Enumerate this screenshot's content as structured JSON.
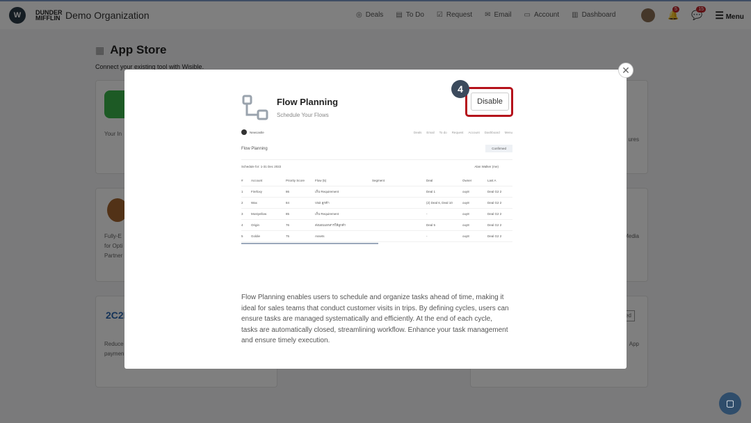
{
  "header": {
    "org_name": "Demo Organization",
    "brand": "DUNDER MIFFLIN",
    "nav": [
      {
        "label": "Deals",
        "icon": "deals-icon"
      },
      {
        "label": "To Do",
        "icon": "todo-icon"
      },
      {
        "label": "Request",
        "icon": "request-icon"
      },
      {
        "label": "Email",
        "icon": "email-icon"
      },
      {
        "label": "Account",
        "icon": "account-icon"
      },
      {
        "label": "Dashboard",
        "icon": "dashboard-icon"
      }
    ],
    "notifications": "5",
    "messages": "15",
    "menu": "Menu"
  },
  "page": {
    "title": "App Store",
    "subtitle": "Connect your existing tool with Wisible."
  },
  "cards": [
    "Your In",
    "ures",
    "Fully-E\nfor Opti\nPartner",
    "Media",
    "Reduce\npaymen",
    "ed",
    "App"
  ],
  "modal": {
    "step": "4",
    "title": "Flow Planning",
    "subtitle": "Schedule Your Flows",
    "disable_label": "Disable",
    "preview": {
      "org": "Newcastle",
      "nav": [
        "Deals",
        "Email",
        "To do",
        "Request",
        "Account",
        "Dashboard",
        "Menu"
      ],
      "title": "Flow Planning",
      "status": "Confirmed",
      "schedule": "Schedule for: 1-31 Dec 2022",
      "user": "Alan Walker (me)",
      "columns": [
        "#",
        "Account",
        "Priority Score",
        "Flow (5)",
        "Segment",
        "Deal",
        "Owner",
        "Last A"
      ],
      "rows": [
        [
          "1",
          "Firefoxy",
          "86",
          "เก็บ Requirement",
          "Deal 1",
          "ouy8",
          "Deal G2 2"
        ],
        [
          "2",
          "Wax",
          "84",
          "Visit ลูกค้า",
          "(2) Deal 6, Deal 10",
          "ouy8",
          "Deal G2 2"
        ],
        [
          "3",
          "Mostyellow",
          "85",
          "เก็บ Requirement",
          "-",
          "ouy8",
          "Deal G2 2"
        ],
        [
          "4",
          "Origin",
          "76",
          "ส่งมอบเอกสารให้ลูกค้า",
          "Deal 5",
          "ouy8",
          "Deal G2 2"
        ],
        [
          "5",
          "Goldie",
          "75",
          "Assets",
          "-",
          "ouy8",
          "Deal G2 2"
        ]
      ]
    },
    "description": "Flow Planning enables users to schedule and organize tasks ahead of time, making it ideal for sales teams that conduct customer visits in trips. By defining cycles, users can ensure tasks are managed systematically and efficiently. At the end of each cycle, tasks are automatically closed, streamlining workflow. Enhance your task management and ensure timely execution."
  }
}
